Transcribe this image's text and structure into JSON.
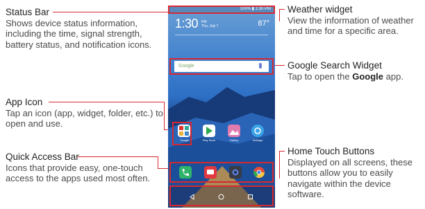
{
  "callouts": {
    "status_bar": {
      "title": "Status Bar",
      "desc": "Shows device status information, including the time, signal strength, battery status, and notification icons."
    },
    "weather_widget": {
      "title": "Weather widget",
      "desc": "View the information of weather and time for a specific area."
    },
    "google_search_widget": {
      "title": "Google Search Widget",
      "desc_pre": "Tap to open the ",
      "desc_bold": "Google",
      "desc_post": " app."
    },
    "app_icon": {
      "title": "App Icon",
      "desc": "Tap an icon (app, widget, folder, etc.) to open and use."
    },
    "quick_access_bar": {
      "title": "Quick Access Bar",
      "desc": "Icons that provide easy, one-touch access to the apps used most often."
    },
    "home_touch_buttons": {
      "title": "Home Touch Buttons",
      "desc": "Displayed on all screens, these buttons allow you to easily navigate within the device software."
    }
  },
  "phone": {
    "status_text": "100% ▮ 1:30 PM",
    "clock": "1:30",
    "clock_suffix": "PM",
    "date_line1": "Thu, July 7",
    "temperature": "87°",
    "search_logo": "Google",
    "app_labels": [
      "Google",
      "Play Store",
      "Gallery",
      "Settings"
    ]
  },
  "colors": {
    "accent": "#d8282f"
  }
}
